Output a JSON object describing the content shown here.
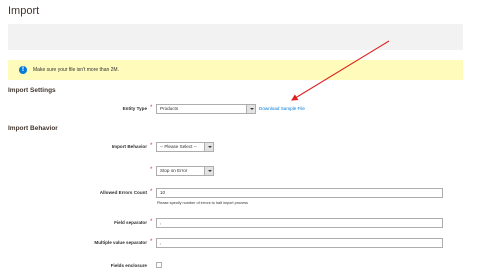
{
  "page": {
    "title": "Import"
  },
  "notice": {
    "icon": "info-icon",
    "text": "Make sure your file isn't more than 2M."
  },
  "import_settings": {
    "title": "Import Settings",
    "entity_type": {
      "label": "Entity Type",
      "value": "Products",
      "required": true
    },
    "download_link": "Download Sample File"
  },
  "import_behavior": {
    "title": "Import Behavior",
    "behavior": {
      "label": "Import Behavior",
      "value": "-- Please Select --",
      "required": true
    },
    "validation": {
      "value": "Stop on Error",
      "required": true
    },
    "allowed_errors": {
      "label": "Allowed Errors Count",
      "value": "10",
      "note": "Please specify number of errors to halt import process",
      "required": true
    },
    "field_separator": {
      "label": "Field separator",
      "value": ",",
      "required": true
    },
    "multiple_value_separator": {
      "label": "Multiple value separator",
      "value": ",",
      "required": true
    },
    "fields_enclosure": {
      "label": "Fields enclosure",
      "checked": false
    }
  },
  "colors": {
    "annotation_arrow": "#e02020",
    "link": "#007bdb",
    "notice_bg": "#fffbbb"
  }
}
